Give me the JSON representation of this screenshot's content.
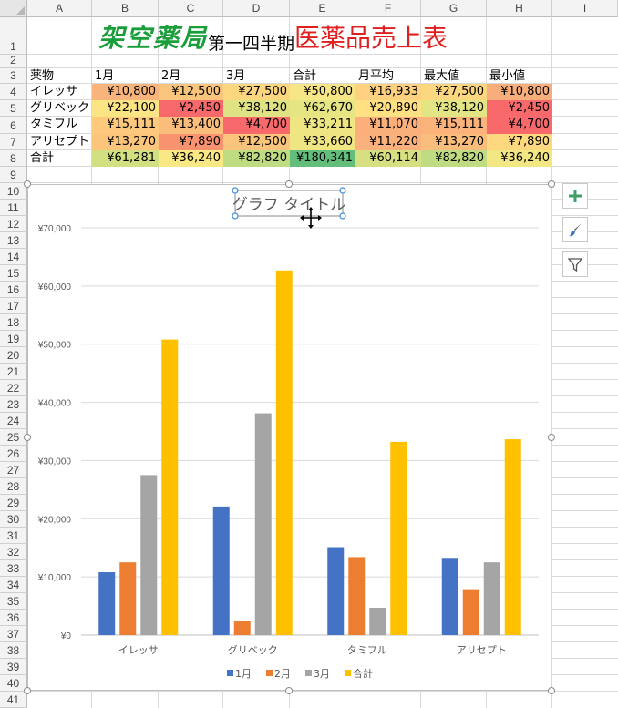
{
  "columns": [
    "A",
    "B",
    "C",
    "D",
    "E",
    "F",
    "G",
    "H",
    "I"
  ],
  "rows": [
    "1",
    "2",
    "3",
    "4",
    "5",
    "6",
    "7",
    "8",
    "9",
    "10",
    "11",
    "12",
    "13",
    "14",
    "15",
    "16",
    "17",
    "18",
    "19",
    "20",
    "21",
    "22",
    "23",
    "24",
    "25",
    "26",
    "27",
    "28",
    "29",
    "30",
    "31",
    "32",
    "33",
    "34",
    "35",
    "36",
    "37",
    "38",
    "39",
    "40",
    "41"
  ],
  "title": {
    "part1": "架空薬局",
    "part2": "第一四半期",
    "part3": "医薬品売上表"
  },
  "table": {
    "headers": [
      "薬物",
      "1月",
      "2月",
      "3月",
      "合計",
      "月平均",
      "最大値",
      "最小値"
    ],
    "rows": [
      {
        "label": "イレッサ",
        "values": [
          "¥10,800",
          "¥12,500",
          "¥27,500",
          "¥50,800",
          "¥16,933",
          "¥27,500",
          "¥10,800"
        ],
        "colors": [
          "#f8b47b",
          "#f9c47c",
          "#fcd780",
          "#f7e685",
          "#fdd17f",
          "#fcd780",
          "#f8ae7a"
        ]
      },
      {
        "label": "グリベック",
        "values": [
          "¥22,100",
          "¥2,450",
          "¥38,120",
          "¥62,670",
          "¥20,890",
          "¥38,120",
          "¥2,450"
        ],
        "colors": [
          "#fbe483",
          "#f8696b",
          "#e0e383",
          "#e6e583",
          "#ffe183",
          "#e3e483",
          "#f8696b"
        ]
      },
      {
        "label": "タミフル",
        "values": [
          "¥15,111",
          "¥13,400",
          "¥4,700",
          "¥33,211",
          "¥11,070",
          "¥15,111",
          "¥4,700"
        ],
        "colors": [
          "#fcc97d",
          "#fbbd7b",
          "#f8696b",
          "#eee683",
          "#fbb07b",
          "#fbb27b",
          "#f8696b"
        ]
      },
      {
        "label": "アリセプト",
        "values": [
          "¥13,270",
          "¥7,890",
          "¥12,500",
          "¥33,660",
          "¥11,220",
          "¥13,270",
          "¥7,890"
        ],
        "colors": [
          "#fcc57c",
          "#f9926f",
          "#fbc47c",
          "#efe683",
          "#fbb17b",
          "#fbbd7b",
          "#fdd87f"
        ]
      },
      {
        "label": "合計",
        "values": [
          "¥61,281",
          "¥36,240",
          "¥82,820",
          "¥180,341",
          "¥60,114",
          "¥82,820",
          "¥36,240"
        ],
        "colors": [
          "#d2e082",
          "#f9e884",
          "#bfdc82",
          "#63be7b",
          "#d6e082",
          "#bfdc82",
          "#f2e783"
        ]
      }
    ]
  },
  "chart_data": {
    "type": "bar",
    "title": "グラフ タイトル",
    "categories": [
      "イレッサ",
      "グリベック",
      "タミフル",
      "アリセプト"
    ],
    "series": [
      {
        "name": "1月",
        "values": [
          10800,
          22100,
          15111,
          13270
        ],
        "color": "#4472c4"
      },
      {
        "name": "2月",
        "values": [
          12500,
          2450,
          13400,
          7890
        ],
        "color": "#ed7d31"
      },
      {
        "name": "3月",
        "values": [
          27500,
          38120,
          4700,
          12500
        ],
        "color": "#a5a5a5"
      },
      {
        "name": "合計",
        "values": [
          50800,
          62670,
          33211,
          33660
        ],
        "color": "#ffc000"
      }
    ],
    "ylim": [
      0,
      70000
    ],
    "yticks": [
      "¥0",
      "¥10,000",
      "¥20,000",
      "¥30,000",
      "¥40,000",
      "¥50,000",
      "¥60,000",
      "¥70,000"
    ],
    "grid": true,
    "legend": "bottom"
  },
  "side_buttons": [
    "plus-icon",
    "brush-icon",
    "filter-icon"
  ]
}
